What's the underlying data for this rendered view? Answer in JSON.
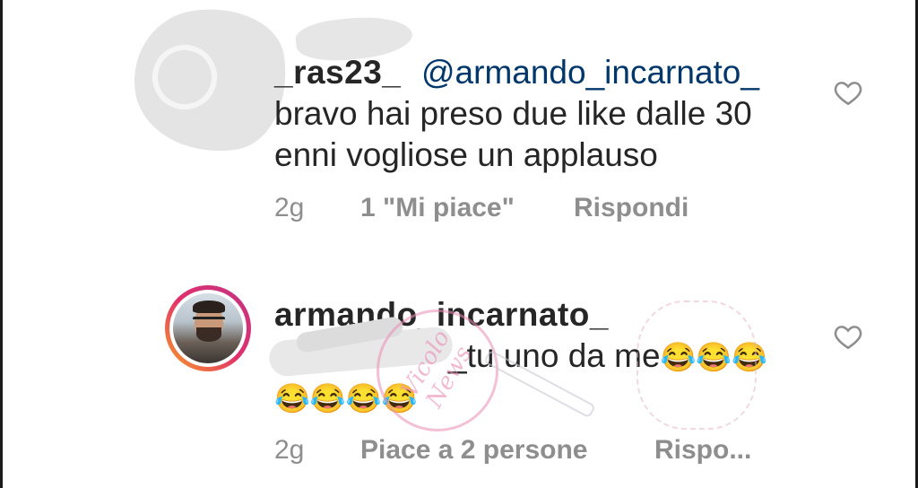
{
  "comments": [
    {
      "username": "_ras23_",
      "mention": "@armando_incarnato_",
      "lines": [
        "bravo hai preso  due like dalle 30",
        "enni vogliose un applauso"
      ],
      "time": "2g",
      "likes": "1 \"Mi piace\"",
      "reply": "Rispondi"
    },
    {
      "username": "armando_incarnato_",
      "lines": [
        "_tu uno da me"
      ],
      "emoji_line1": "😂😂😂",
      "emoji_line2": "😂😂😂😂",
      "time": "2g",
      "likes": "Piace a 2 persone",
      "reply": "Rispo..."
    }
  ],
  "watermark": {
    "text": "Vicolo News"
  },
  "icons": {
    "like": "heart-outline-icon"
  },
  "colors": {
    "text": "#262626",
    "mention": "#00376b",
    "meta": "#8e8e8e"
  }
}
